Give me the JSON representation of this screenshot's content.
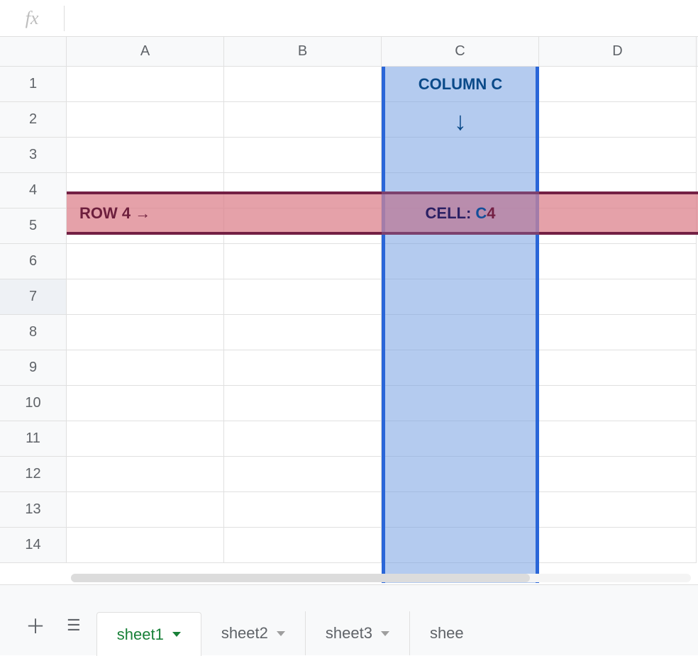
{
  "formula_bar": {
    "fx_label": "fx",
    "value": ""
  },
  "columns": [
    "A",
    "B",
    "C",
    "D"
  ],
  "rows": [
    "1",
    "2",
    "3",
    "4",
    "5",
    "6",
    "7",
    "8",
    "9",
    "10",
    "11",
    "12",
    "13",
    "14"
  ],
  "selected_row_header": "7",
  "highlight": {
    "column_label": "COLUMN C",
    "column_arrow": "↓",
    "row_label": "ROW 4  →",
    "cell_prefix": "CELL:",
    "cell_ref_col": "C",
    "cell_ref_row": "4"
  },
  "sheets": {
    "tabs": [
      {
        "name": "sheet1",
        "active": true
      },
      {
        "name": "sheet2",
        "active": false
      },
      {
        "name": "sheet3",
        "active": false
      }
    ],
    "partial_tab": "shee"
  }
}
